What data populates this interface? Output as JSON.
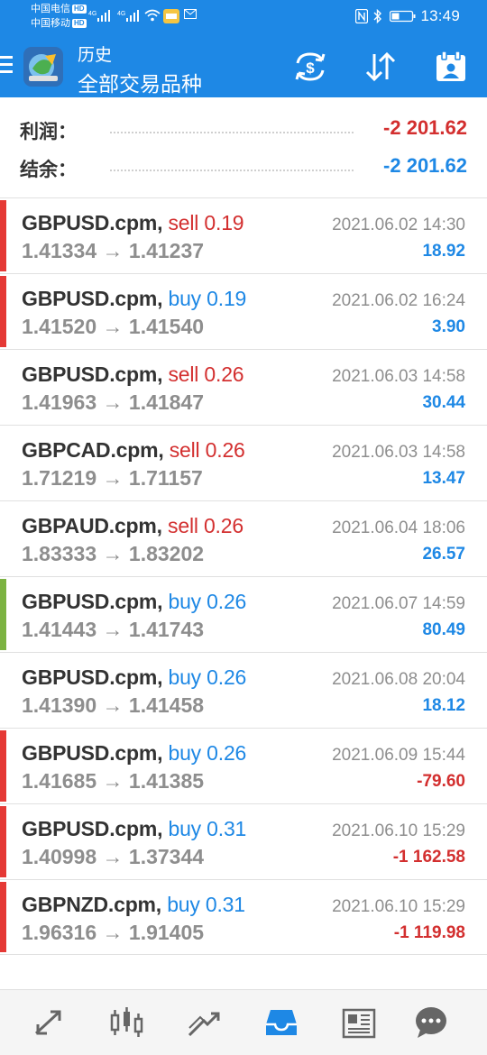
{
  "status_bar": {
    "carrier1": "中国电信",
    "carrier2": "中国移动",
    "hd": "HD",
    "net": "4G",
    "time": "13:49"
  },
  "header": {
    "title": "历史",
    "subtitle": "全部交易品种",
    "background_color": "#1e88e5"
  },
  "summary": {
    "profit_label": "利润：",
    "profit_value": "-2 201.62",
    "balance_label": "结余：",
    "balance_value": "-2 201.62"
  },
  "deals": [
    {
      "symbol": "GBPUSD.cpm,",
      "side": "sell",
      "volume": "0.19",
      "prices": "1.41334 → 1.41237",
      "date": "2021.06.02 14:30",
      "profit": "18.92",
      "bar": "red"
    },
    {
      "symbol": "GBPUSD.cpm,",
      "side": "buy",
      "volume": "0.19",
      "prices": "1.41520 → 1.41540",
      "date": "2021.06.02 16:24",
      "profit": "3.90",
      "bar": "red"
    },
    {
      "symbol": "GBPUSD.cpm,",
      "side": "sell",
      "volume": "0.26",
      "prices": "1.41963 → 1.41847",
      "date": "2021.06.03 14:58",
      "profit": "30.44",
      "bar": "none"
    },
    {
      "symbol": "GBPCAD.cpm,",
      "side": "sell",
      "volume": "0.26",
      "prices": "1.71219 → 1.71157",
      "date": "2021.06.03 14:58",
      "profit": "13.47",
      "bar": "none"
    },
    {
      "symbol": "GBPAUD.cpm,",
      "side": "sell",
      "volume": "0.26",
      "prices": "1.83333 → 1.83202",
      "date": "2021.06.04 18:06",
      "profit": "26.57",
      "bar": "none"
    },
    {
      "symbol": "GBPUSD.cpm,",
      "side": "buy",
      "volume": "0.26",
      "prices": "1.41443 → 1.41743",
      "date": "2021.06.07 14:59",
      "profit": "80.49",
      "bar": "green"
    },
    {
      "symbol": "GBPUSD.cpm,",
      "side": "buy",
      "volume": "0.26",
      "prices": "1.41390 → 1.41458",
      "date": "2021.06.08 20:04",
      "profit": "18.12",
      "bar": "none"
    },
    {
      "symbol": "GBPUSD.cpm,",
      "side": "buy",
      "volume": "0.26",
      "prices": "1.41685 → 1.41385",
      "date": "2021.06.09 15:44",
      "profit": "-79.60",
      "bar": "red"
    },
    {
      "symbol": "GBPUSD.cpm,",
      "side": "buy",
      "volume": "0.31",
      "prices": "1.40998 → 1.37344",
      "date": "2021.06.10 15:29",
      "profit": "-1 162.58",
      "bar": "red"
    },
    {
      "symbol": "GBPNZD.cpm,",
      "side": "buy",
      "volume": "0.31",
      "prices": "1.96316 → 1.91405",
      "date": "2021.06.10 15:29",
      "profit": "-1 119.98",
      "bar": "red"
    }
  ],
  "colors": {
    "accent": "#1e88e5",
    "negative": "#d32f2f",
    "bar_red": "#e53935",
    "bar_green": "#7cb342"
  },
  "bottom_nav": [
    {
      "icon": "quotes-icon",
      "active": false
    },
    {
      "icon": "chart-icon",
      "active": false
    },
    {
      "icon": "trade-icon",
      "active": false
    },
    {
      "icon": "history-icon",
      "active": true
    },
    {
      "icon": "news-icon",
      "active": false
    },
    {
      "icon": "chat-icon",
      "active": false
    }
  ]
}
